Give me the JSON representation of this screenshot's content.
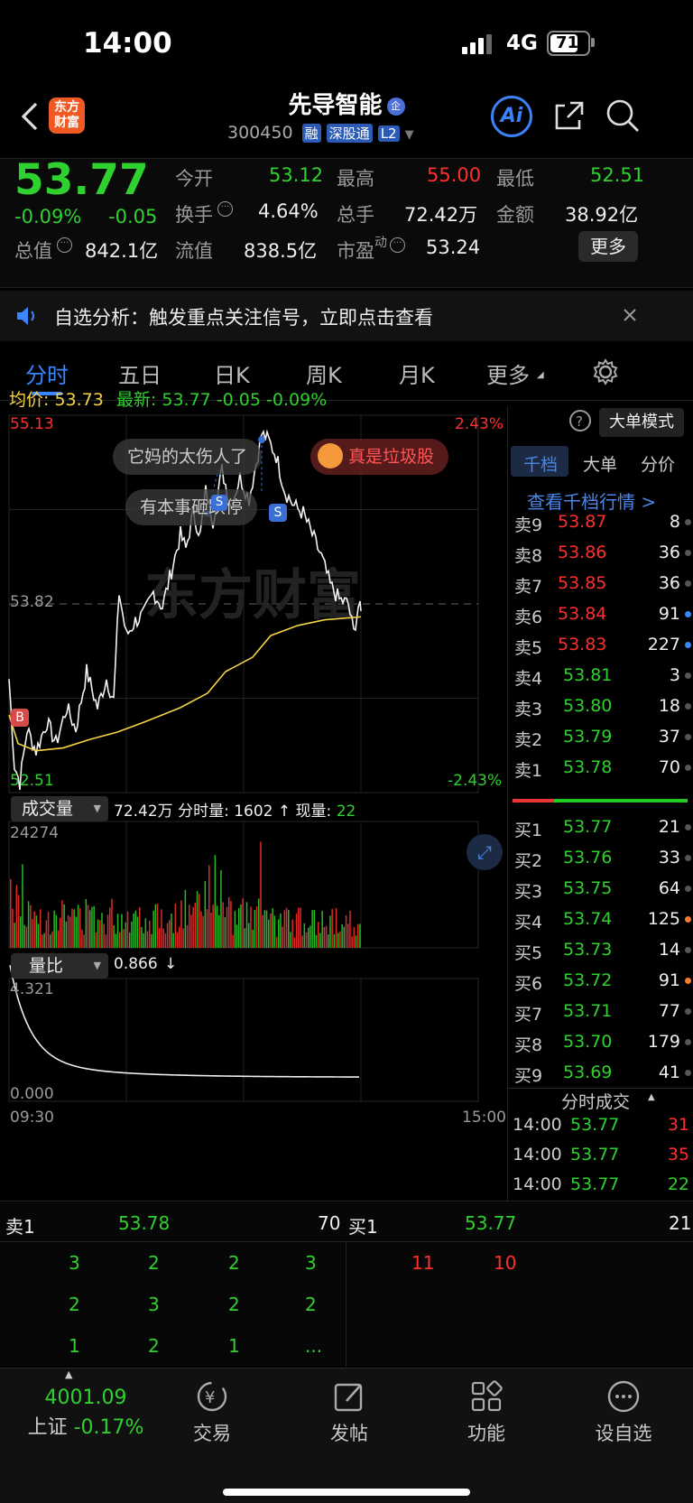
{
  "status": {
    "time": "14:00",
    "network": "4G",
    "battery": "71"
  },
  "header": {
    "logo_text": [
      "东方",
      "财富"
    ],
    "stock_name": "先导智能",
    "name_badge": "企",
    "stock_code": "300450",
    "tags": [
      "融",
      "深股通",
      "L2"
    ],
    "ai_label": "Ai"
  },
  "quote": {
    "price": "53.77",
    "change_pct": "-0.09%",
    "change": "-0.05",
    "open_label": "今开",
    "open": "53.12",
    "high_label": "最高",
    "high": "55.00",
    "low_label": "最低",
    "low": "52.51",
    "turnover_label": "换手",
    "turnover": "4.64%",
    "volume_label": "总手",
    "volume": "72.42万",
    "amount_label": "金额",
    "amount": "38.92亿",
    "mktcap_label": "总值",
    "mktcap": "842.1亿",
    "float_label": "流值",
    "float": "838.5亿",
    "pe_label": "市盈",
    "pe_sup": "动",
    "pe": "53.24",
    "more_button": "更多"
  },
  "notice": {
    "text": "自选分析：触发重点关注信号，立即点击查看"
  },
  "tabs": [
    "分时",
    "五日",
    "日K",
    "周K",
    "月K",
    "更多"
  ],
  "chart_info": {
    "avg_label": "均价:",
    "avg": "53.73",
    "latest_label": "最新:",
    "latest": "53.77",
    "latest_chg": "-0.05",
    "latest_pct": "-0.09%",
    "big_order_mode": "大单模式"
  },
  "chart_labels": {
    "price_high": "55.13",
    "price_mid": "53.82",
    "price_low": "52.51",
    "pct_high": "2.43%",
    "pct_low": "-2.43%",
    "marker_b": "B",
    "marker_s": "S",
    "watermark": "东方财富"
  },
  "comments": [
    "它妈的太伤人了",
    "真是垃圾股",
    "有本事砸跌停"
  ],
  "volume_panel": {
    "selector": "成交量",
    "total": "72.42万",
    "minute_label": "分时量:",
    "minute_val": "1602",
    "now_label": "现量:",
    "now_val": "22",
    "axis_max": "24274"
  },
  "ratio_panel": {
    "selector": "量比",
    "value": "0.866",
    "axis_max": "4.321",
    "axis_min": "0.000",
    "time_start": "09:30",
    "time_end": "15:00"
  },
  "orderbook_tabs": [
    "千档",
    "大单",
    "分价"
  ],
  "orderbook_link": "查看千档行情 >",
  "asks": [
    {
      "label": "卖9",
      "price": "53.87",
      "vol": "8"
    },
    {
      "label": "卖8",
      "price": "53.86",
      "vol": "36"
    },
    {
      "label": "卖7",
      "price": "53.85",
      "vol": "36"
    },
    {
      "label": "卖6",
      "price": "53.84",
      "vol": "91"
    },
    {
      "label": "卖5",
      "price": "53.83",
      "vol": "227"
    },
    {
      "label": "卖4",
      "price": "53.81",
      "vol": "3"
    },
    {
      "label": "卖3",
      "price": "53.80",
      "vol": "18"
    },
    {
      "label": "卖2",
      "price": "53.79",
      "vol": "37"
    },
    {
      "label": "卖1",
      "price": "53.78",
      "vol": "70"
    }
  ],
  "bids": [
    {
      "label": "买1",
      "price": "53.77",
      "vol": "21"
    },
    {
      "label": "买2",
      "price": "53.76",
      "vol": "33"
    },
    {
      "label": "买3",
      "price": "53.75",
      "vol": "64"
    },
    {
      "label": "买4",
      "price": "53.74",
      "vol": "125"
    },
    {
      "label": "买5",
      "price": "53.73",
      "vol": "14"
    },
    {
      "label": "买6",
      "price": "53.72",
      "vol": "91"
    },
    {
      "label": "买7",
      "price": "53.71",
      "vol": "77"
    },
    {
      "label": "买8",
      "price": "53.70",
      "vol": "179"
    },
    {
      "label": "买9",
      "price": "53.69",
      "vol": "41"
    }
  ],
  "ticks_title": "分时成交",
  "ticks": [
    {
      "time": "14:00",
      "price": "53.77",
      "vol": "31"
    },
    {
      "time": "14:00",
      "price": "53.77",
      "vol": "35"
    },
    {
      "time": "14:00",
      "price": "53.77",
      "vol": "22"
    }
  ],
  "queue": {
    "sell_label": "卖1",
    "sell_price": "53.78",
    "sell_total": "70",
    "buy_label": "买1",
    "buy_price": "53.77",
    "buy_total": "21",
    "sell_orders": [
      [
        "3",
        "2",
        "2",
        "3"
      ],
      [
        "2",
        "3",
        "2",
        "2"
      ],
      [
        "1",
        "2",
        "1",
        "..."
      ]
    ],
    "buy_orders": [
      "11",
      "10"
    ]
  },
  "bottom_nav": {
    "index_value": "4001.09",
    "index_name": "上证",
    "index_pct": "-0.17%",
    "items": [
      "交易",
      "发帖",
      "功能",
      "设自选"
    ]
  },
  "colors": {
    "up": "#ff2f2f",
    "down": "#2fd12f",
    "avg_line": "#f5d442",
    "accent": "#3a86ff"
  }
}
